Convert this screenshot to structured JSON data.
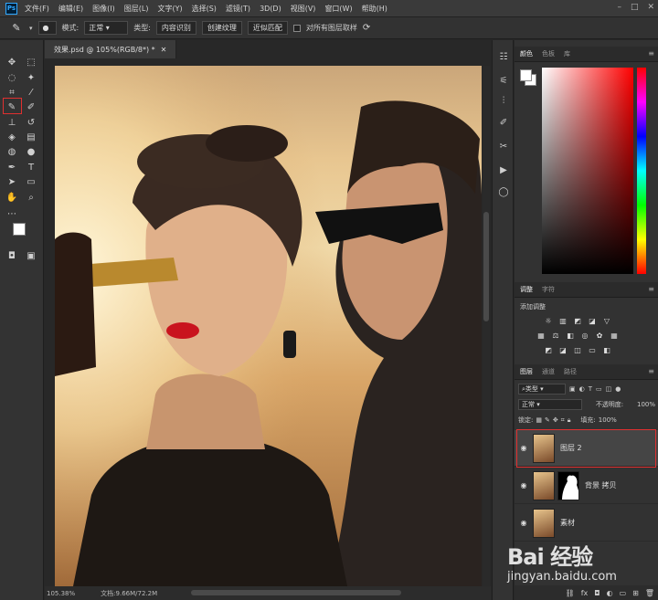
{
  "menubar": {
    "logo": "Ps",
    "items": [
      "文件(F)",
      "编辑(E)",
      "图像(I)",
      "图层(L)",
      "文字(Y)",
      "选择(S)",
      "滤镜(T)",
      "3D(D)",
      "视图(V)",
      "窗口(W)",
      "帮助(H)"
    ],
    "window_controls": [
      "–",
      "□",
      "✕"
    ]
  },
  "options": {
    "mode_label": "模式:",
    "mode_value": "正常",
    "type_label": "类型:",
    "btn_content_aware": "内容识别",
    "btn_create_texture": "创建纹理",
    "btn_proximity": "近似匹配",
    "sample_all_label": "对所有图层取样"
  },
  "document": {
    "tab_title": "效果.psd @ 105%(RGB/8*) *",
    "status_zoom": "105.38%",
    "status_doc": "文档:9.66M/72.2M"
  },
  "panels": {
    "color_tabs": [
      "颜色",
      "色板",
      "库"
    ],
    "adjust_tabs": [
      "调整",
      "字符"
    ],
    "adjust_title": "添加调整",
    "layers_tabs": [
      "图层",
      "通道",
      "路径"
    ],
    "filter_label": "类型",
    "blend_mode": "正常",
    "opacity_label": "不透明度:",
    "opacity_value": "100%",
    "lock_label": "锁定:",
    "fill_label": "填充:",
    "fill_value": "100%",
    "layers": [
      {
        "name": "图层 2"
      },
      {
        "name": "背景 拷贝"
      },
      {
        "name": "素材"
      }
    ]
  },
  "watermark": {
    "logo_text": "Bai 经验",
    "url": "jingyan.baidu.com"
  }
}
